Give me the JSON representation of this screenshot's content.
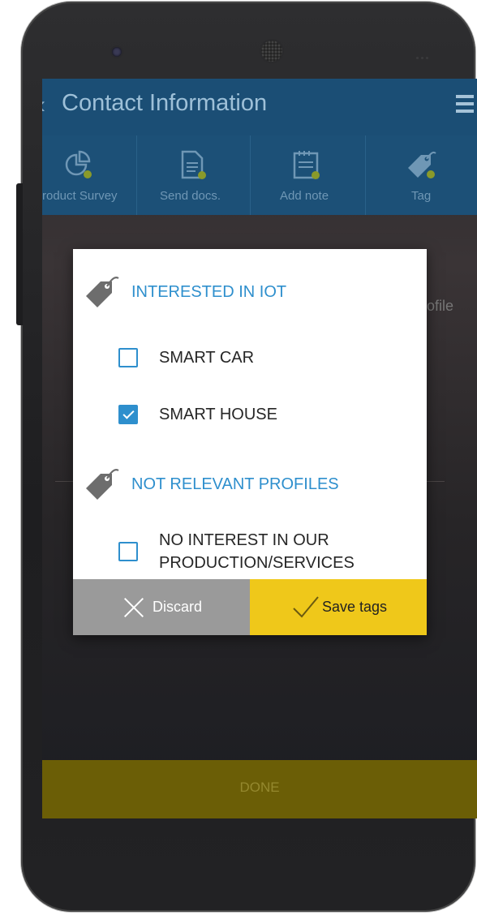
{
  "app": {
    "title": "Contact Information",
    "back_glyph": "‹",
    "menu_icon": "hamburger-icon"
  },
  "actions": [
    {
      "label": "Product Survey",
      "icon": "survey-chart-icon"
    },
    {
      "label": "Send docs.",
      "icon": "document-icon"
    },
    {
      "label": "Add note",
      "icon": "note-icon"
    },
    {
      "label": "Tag",
      "icon": "tag-icon"
    }
  ],
  "background": {
    "profile_fragment": "rofile",
    "done_label": "DONE"
  },
  "dialog": {
    "groups": [
      {
        "title": "INTERESTED IN IOT",
        "icon": "tag-icon",
        "options": [
          {
            "label": "SMART CAR",
            "checked": false
          },
          {
            "label": "SMART HOUSE",
            "checked": true
          }
        ]
      },
      {
        "title": "NOT RELEVANT PROFILES",
        "icon": "tag-icon",
        "options": [
          {
            "label_line1": "NO INTEREST IN OUR",
            "label_line2": "PRODUCTION/SERVICES",
            "checked": false
          }
        ]
      }
    ],
    "discard_label": "Discard",
    "save_label": "Save tags"
  },
  "colors": {
    "accent_blue": "#2e8fcd",
    "toolbar_blue": "#1b4e75",
    "save_yellow": "#efc81a",
    "discard_gray": "#9a9a9a",
    "done_olive": "#6b5e06"
  }
}
